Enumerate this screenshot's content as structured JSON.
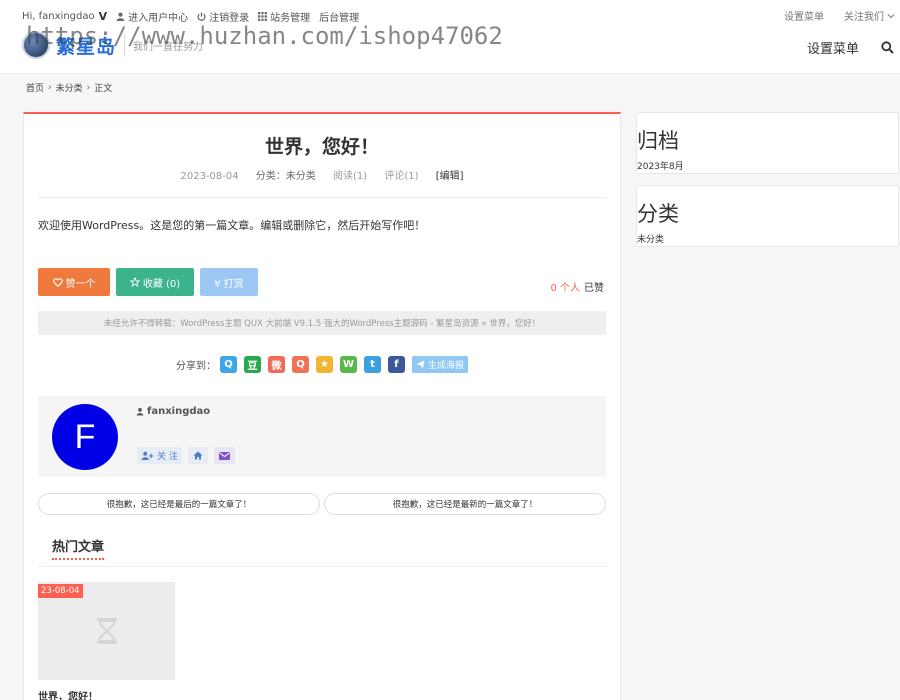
{
  "topbar": {
    "greeting": "Hi, fanxingdao",
    "vip_badge": "V",
    "user_center": "进入用户中心",
    "logout": "注销登录",
    "site_admin": "站务管理",
    "backend_admin": "后台管理",
    "menu_setup": "设置菜单",
    "follow_us": "关注我们"
  },
  "logo": {
    "text": "繁星岛",
    "slogan": "我们一直在努力"
  },
  "watermark": "https://www.huzhan.com/ishop47062",
  "nav": {
    "menu_label": "设置菜单"
  },
  "breadcrumb": {
    "home": "首页",
    "category": "未分类",
    "current": "正文"
  },
  "post": {
    "title": "世界，您好！",
    "date": "2023-08-04",
    "category": "分类：未分类",
    "reads": "阅读(1)",
    "comments": "评论(1)",
    "edit": "[编辑]",
    "content": "欢迎使用WordPress。这是您的第一篇文章。编辑或删除它，然后开始写作吧！"
  },
  "actions": {
    "like": "赞一个",
    "favorite": "收藏 (0)",
    "reward": "¥ 打赏",
    "likes_num": "0 个人",
    "likes_suffix": "已赞"
  },
  "copyright": "未经允许不得转载：WordPress主题 QUX 大前端 V9.1.5 强大的WordPress主题源码 - 繁星岛资源 » 世界，您好！",
  "share": {
    "label": "分享到：",
    "poster": "生成海报",
    "icons": [
      {
        "name": "qzone-icon",
        "color": "#3fa6e6",
        "glyph": "Q"
      },
      {
        "name": "douban-icon",
        "color": "#2aa84f",
        "glyph": "豆"
      },
      {
        "name": "weibo-icon",
        "color": "#f26a5a",
        "glyph": "微"
      },
      {
        "name": "qq-icon",
        "color": "#f07355",
        "glyph": "Q"
      },
      {
        "name": "star-icon",
        "color": "#f2b431",
        "glyph": "★"
      },
      {
        "name": "wechat-icon",
        "color": "#58b84a",
        "glyph": "W"
      },
      {
        "name": "tqq-icon",
        "color": "#3ba0e0",
        "glyph": "t"
      },
      {
        "name": "facebook-icon",
        "color": "#3b5998",
        "glyph": "f"
      }
    ]
  },
  "author": {
    "avatar_letter": "F",
    "name": "fanxingdao",
    "follow": "关 注"
  },
  "pagination": {
    "prev": "很抱歉，这已经是最后的一篇文章了！",
    "next": "很抱歉，这已经是最新的一篇文章了！"
  },
  "hot": {
    "title": "热门文章",
    "date_badge": "23-08-04",
    "caption": "世界，您好！"
  },
  "sidebar": {
    "archive_title": "归档",
    "archive_item": "2023年8月",
    "category_title": "分类",
    "category_item": "未分类"
  },
  "colors": {
    "accent": "#ff5e52",
    "like": "#f0793e",
    "favorite": "#3bb38d",
    "reward": "#9cc7f5",
    "avatar": "#0000e6"
  }
}
